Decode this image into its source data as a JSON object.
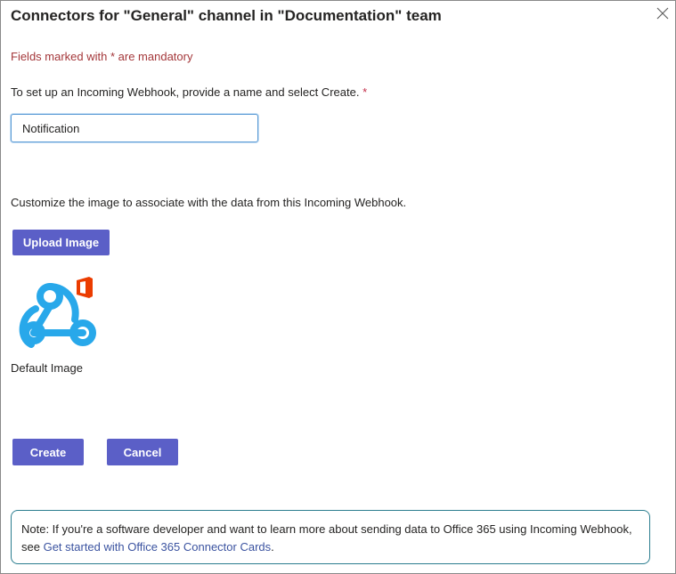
{
  "dialog": {
    "title": "Connectors for \"General\" channel in \"Documentation\" team",
    "close_icon": "close-icon"
  },
  "form": {
    "mandatory_note": "Fields marked with * are mandatory",
    "setup_text": "To set up an Incoming Webhook, provide a name and select Create.",
    "required_marker": "*",
    "name_value": "Notification"
  },
  "image_section": {
    "customize_text": "Customize the image to associate with the data from this Incoming Webhook.",
    "upload_label": "Upload Image",
    "default_image_icon": "webhook-icon",
    "office_badge_icon": "office-icon",
    "default_image_label": "Default Image"
  },
  "actions": {
    "create_label": "Create",
    "cancel_label": "Cancel"
  },
  "note": {
    "text": "Note: If you're a software developer and want to learn more about sending data to Office 365 using Incoming Webhook, see ",
    "link_text": "Get started with Office 365 Connector Cards",
    "suffix": "."
  },
  "colors": {
    "primary_button": "#5b5fc7",
    "mandatory_text": "#a4373a",
    "webhook_blue": "#28a8ea",
    "office_red": "#eb3c00",
    "note_border": "#2b7d8f",
    "link": "#3b53a0"
  }
}
